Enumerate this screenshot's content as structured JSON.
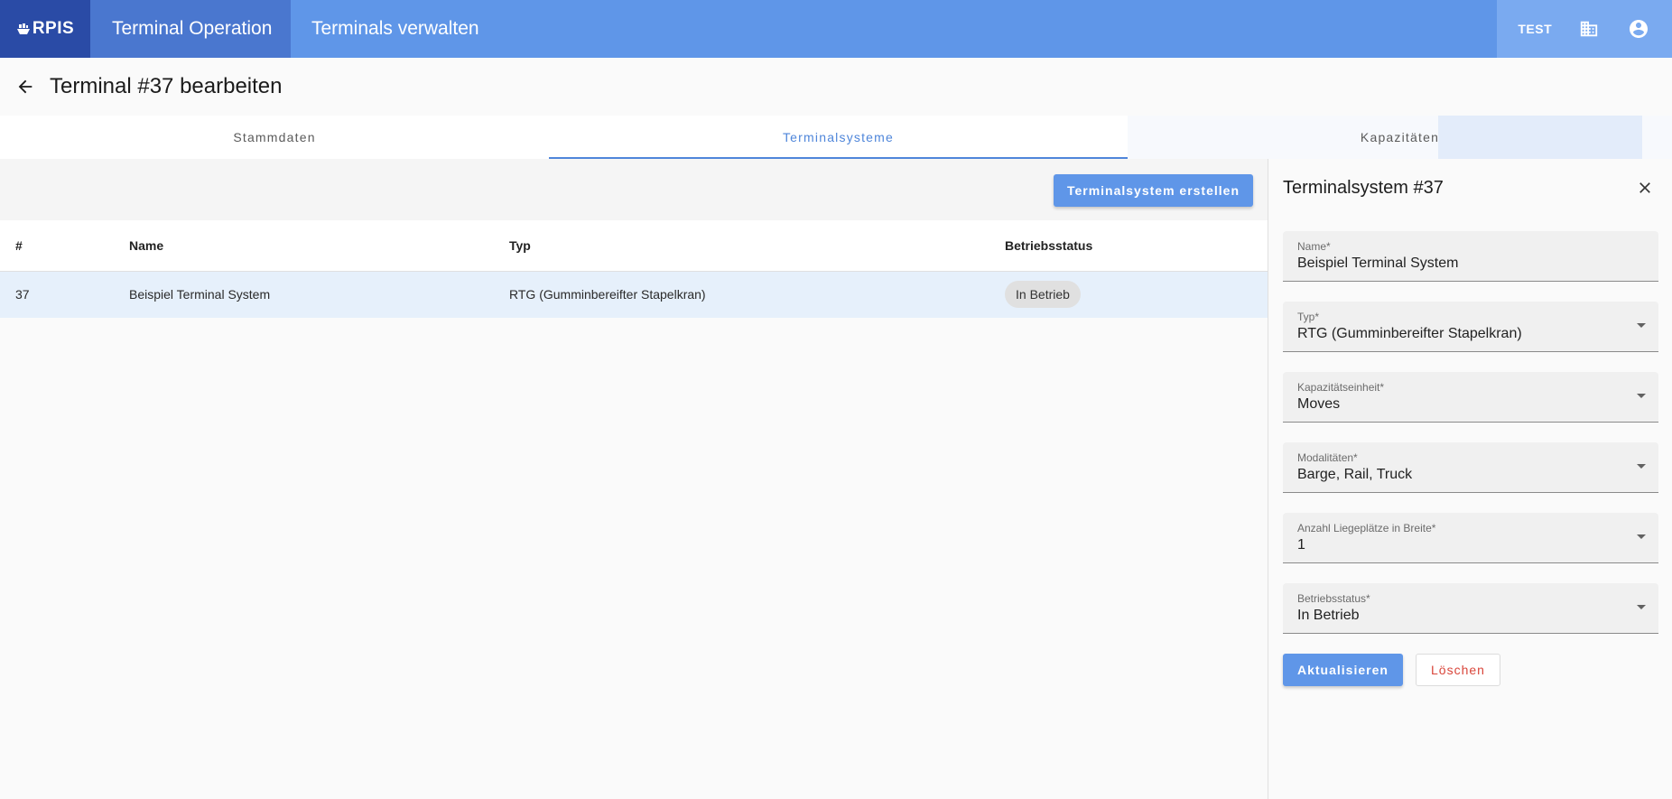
{
  "header": {
    "logo": "RPIS",
    "nav_active": "Terminal Operation",
    "nav_item": "Terminals verwalten",
    "tenant": "TEST",
    "icons": [
      "building-icon",
      "account-circle-icon"
    ]
  },
  "page": {
    "title": "Terminal #37 bearbeiten"
  },
  "tabs": [
    {
      "label": "Stammdaten",
      "active": false
    },
    {
      "label": "Terminalsysteme",
      "active": true
    },
    {
      "label": "Kapazitäten",
      "active": false
    }
  ],
  "main": {
    "create_button": "Terminalsystem erstellen",
    "table": {
      "headers": [
        "#",
        "Name",
        "Typ",
        "Betriebsstatus"
      ],
      "rows": [
        {
          "id": "37",
          "name": "Beispiel Terminal System",
          "typ": "RTG (Gumminbereifter Stapelkran)",
          "status": "In Betrieb",
          "selected": true
        }
      ]
    }
  },
  "panel": {
    "title": "Terminalsystem #37",
    "fields": [
      {
        "label": "Name*",
        "value": "Beispiel Terminal System",
        "type": "text"
      },
      {
        "label": "Typ*",
        "value": "RTG (Gumminbereifter Stapelkran)",
        "type": "select"
      },
      {
        "label": "Kapazitätseinheit*",
        "value": "Moves",
        "type": "select"
      },
      {
        "label": "Modalitäten*",
        "value": "Barge, Rail, Truck",
        "type": "select"
      },
      {
        "label": "Anzahl Liegeplätze in Breite*",
        "value": "1",
        "type": "select"
      },
      {
        "label": "Betriebsstatus*",
        "value": "In Betrieb",
        "type": "select"
      }
    ],
    "update_button": "Aktualisieren",
    "delete_button": "Löschen"
  },
  "colors": {
    "brand_dark": "#2a4ba6",
    "brand": "#5f96e8",
    "accent_tab": "#4f86da",
    "danger": "#d9453a"
  }
}
